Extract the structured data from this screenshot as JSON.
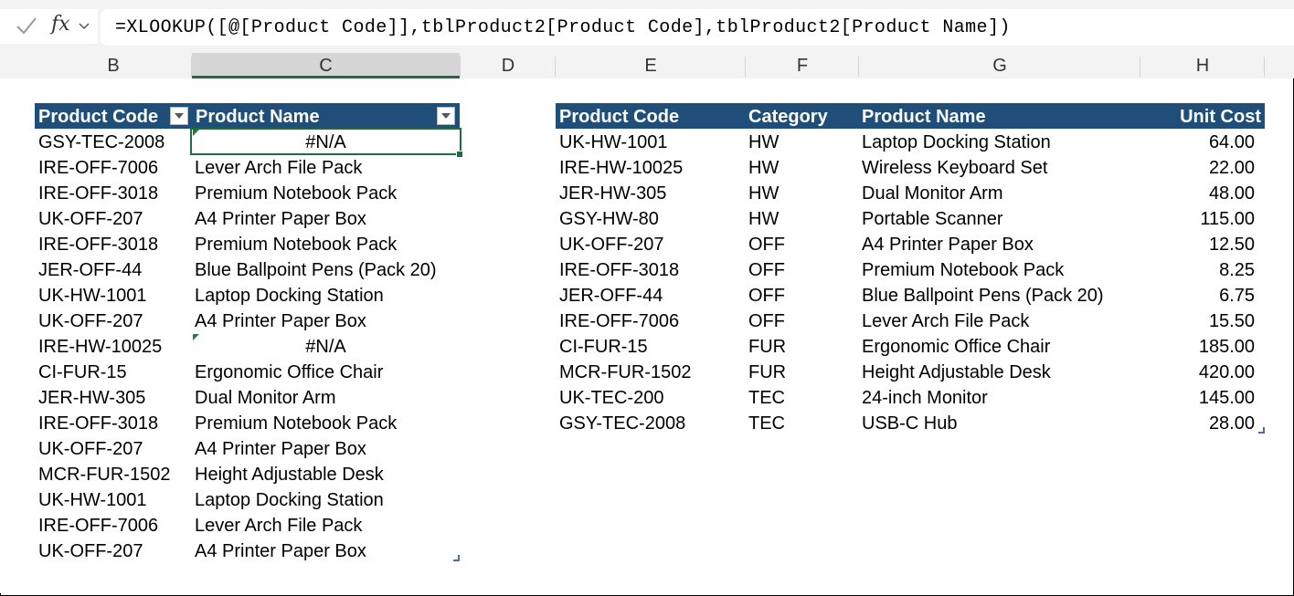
{
  "formula_bar": {
    "fx_label": "fx",
    "formula": "=XLOOKUP([@[Product Code]],tblProduct2[Product Code],tblProduct2[Product Name])"
  },
  "columns": [
    "B",
    "C",
    "D",
    "E",
    "F",
    "G",
    "H"
  ],
  "table1": {
    "headers": [
      "Product Code",
      "Product Name"
    ],
    "rows": [
      [
        "GSY-TEC-2008",
        "#N/A"
      ],
      [
        "IRE-OFF-7006",
        "Lever Arch File Pack"
      ],
      [
        "IRE-OFF-3018",
        "Premium Notebook Pack"
      ],
      [
        "UK-OFF-207",
        "A4 Printer Paper Box"
      ],
      [
        "IRE-OFF-3018",
        "Premium Notebook Pack"
      ],
      [
        "JER-OFF-44",
        "Blue Ballpoint Pens (Pack 20)"
      ],
      [
        "UK-HW-1001",
        "Laptop Docking Station"
      ],
      [
        "UK-OFF-207",
        "A4 Printer Paper Box"
      ],
      [
        "IRE-HW-10025",
        "#N/A"
      ],
      [
        "CI-FUR-15",
        "Ergonomic Office Chair"
      ],
      [
        "JER-HW-305",
        "Dual Monitor Arm"
      ],
      [
        "IRE-OFF-3018",
        "Premium Notebook Pack"
      ],
      [
        "UK-OFF-207",
        "A4 Printer Paper Box"
      ],
      [
        "MCR-FUR-1502",
        "Height Adjustable Desk"
      ],
      [
        "UK-HW-1001",
        "Laptop Docking Station"
      ],
      [
        "IRE-OFF-7006",
        "Lever Arch File Pack"
      ],
      [
        "UK-OFF-207",
        "A4 Printer Paper Box"
      ]
    ]
  },
  "table2": {
    "headers": [
      "Product Code",
      "Category",
      "Product Name",
      "Unit Cost"
    ],
    "rows": [
      [
        "UK-HW-1001",
        "HW",
        "Laptop Docking Station",
        "64.00"
      ],
      [
        "IRE-HW-10025",
        "HW",
        "Wireless Keyboard Set",
        "22.00"
      ],
      [
        "JER-HW-305",
        "HW",
        "Dual Monitor Arm",
        "48.00"
      ],
      [
        "GSY-HW-80",
        "HW",
        "Portable Scanner",
        "115.00"
      ],
      [
        "UK-OFF-207",
        "OFF",
        "A4 Printer Paper Box",
        "12.50"
      ],
      [
        "IRE-OFF-3018",
        "OFF",
        "Premium Notebook Pack",
        "8.25"
      ],
      [
        "JER-OFF-44",
        "OFF",
        "Blue Ballpoint Pens (Pack 20)",
        "6.75"
      ],
      [
        "IRE-OFF-7006",
        "OFF",
        "Lever Arch File Pack",
        "15.50"
      ],
      [
        "CI-FUR-15",
        "FUR",
        "Ergonomic Office Chair",
        "185.00"
      ],
      [
        "MCR-FUR-1502",
        "FUR",
        "Height Adjustable Desk",
        "420.00"
      ],
      [
        "UK-TEC-200",
        "TEC",
        "24-inch Monitor",
        "145.00"
      ],
      [
        "GSY-TEC-2008",
        "TEC",
        "USB-C Hub",
        "28.00"
      ]
    ]
  },
  "colors": {
    "header_bg": "#1f4e79",
    "selection": "#1e6c3f",
    "error_triangle": "#1e7e3e"
  }
}
